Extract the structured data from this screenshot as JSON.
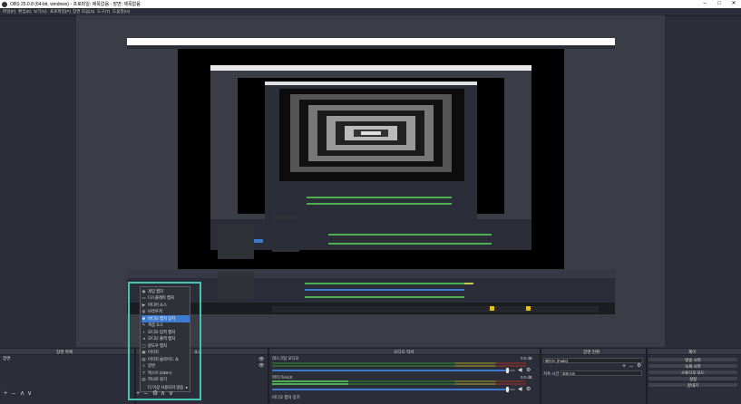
{
  "window": {
    "title": "OBS 25.0.8 (64-bit, windows) - 프로파일: 제목없음 - 장면: 제목없음",
    "minimize": "–",
    "maximize": "□",
    "close": "✕"
  },
  "menu": [
    "파일(F)",
    "편집(E)",
    "보기(V)",
    "프로파일(P)",
    "장면 모음(S)",
    "도구(T)",
    "도움말(H)"
  ],
  "docks": {
    "scenes_title": "장면 목록",
    "sources_title": "소스",
    "mixer_title": "오디오 믹서",
    "transitions_title": "장면 전환",
    "controls_title": "제어"
  },
  "scenes": {
    "items": [
      "장면"
    ],
    "toolbar": [
      "+",
      "–",
      "∧",
      "∨"
    ]
  },
  "sources_toolbar": [
    "+",
    "–",
    "⚙",
    "∧",
    "∨"
  ],
  "context_menu": {
    "items": [
      {
        "label": "게임 캡처",
        "icon": "gamepad-icon"
      },
      {
        "label": "디스플레이 캡처",
        "icon": "monitor-icon"
      },
      {
        "label": "미디어 소스",
        "icon": "play-icon"
      },
      {
        "label": "브라우저",
        "icon": "globe-icon"
      },
      {
        "label": "비디오 캡처 장치",
        "icon": "camera-icon"
      },
      {
        "label": "색상 소스",
        "icon": "brush-icon"
      },
      {
        "label": "오디오 입력 캡처",
        "icon": "mic-icon"
      },
      {
        "label": "오디오 출력 캡처",
        "icon": "speaker-icon"
      },
      {
        "label": "윈도우 캡처",
        "icon": "window-icon"
      },
      {
        "label": "이미지",
        "icon": "image-icon"
      },
      {
        "label": "이미지 슬라이드 쇼",
        "icon": "slides-icon"
      },
      {
        "label": "장면",
        "icon": "list-icon"
      },
      {
        "label": "텍스트 (GDI+)",
        "icon": "text-icon"
      },
      {
        "label": "하나로 묶기",
        "icon": "folder-icon"
      },
      {
        "label": "더 이상 사용되지 않음",
        "icon": ""
      }
    ],
    "highlighted_index": 4,
    "submenu_arrow": "▸"
  },
  "mixer": {
    "tracks": [
      {
        "name": "데스크탑 오디오",
        "db": "0.0 dB",
        "volume": 0.97
      },
      {
        "name": "마이크/AUX",
        "db": "0.0 dB",
        "volume": 0.97
      }
    ],
    "scale": [
      "-60",
      "-55",
      "-50",
      "-45",
      "-40",
      "-35",
      "-30",
      "-25",
      "-20",
      "-15",
      "-10",
      "-5",
      "0"
    ],
    "tracks_extra_label": "비디오 캡처 장치"
  },
  "transitions": {
    "type": "페이드 (Fade)",
    "duration_label": "지속 시간",
    "duration_value": "300 ms"
  },
  "controls": {
    "buttons": [
      "방송 시작",
      "녹화 시작",
      "스튜디오 모드",
      "설정",
      "끝내기"
    ]
  },
  "colors": {
    "accent": "#3d7bd0",
    "highlight_box": "#47c3b2",
    "meter_green": "#4caf50",
    "meter_yellow": "#c8c84b",
    "meter_red": "#c84b4b"
  }
}
